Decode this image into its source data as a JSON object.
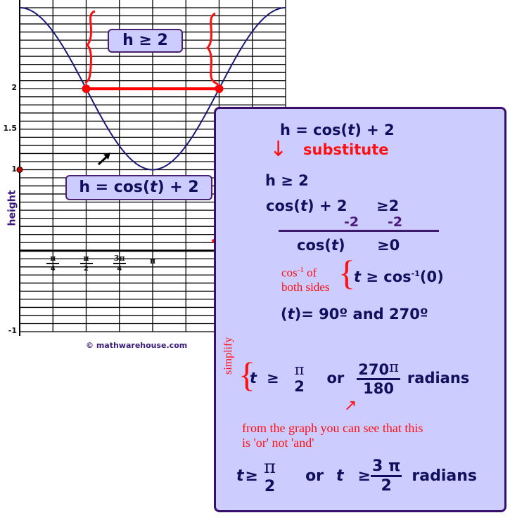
{
  "chart_data": {
    "type": "line",
    "function": "h = cos(t) + 2",
    "x_range_radians": [
      0,
      6.2832
    ],
    "ylim": [
      -1,
      3
    ],
    "ylabel": "height",
    "ytick_labels": [
      {
        "value": 2,
        "label": "2"
      },
      {
        "value": 1.5,
        "label": "1.5"
      },
      {
        "value": 1,
        "label": "1"
      },
      {
        "value": -1,
        "label": "-1"
      }
    ],
    "xtick_labels": [
      {
        "value": 0.7854,
        "num": "π",
        "den": "4"
      },
      {
        "value": 1.5708,
        "num": "π",
        "den": "2"
      },
      {
        "value": 2.3562,
        "num": "3π",
        "den": "4"
      },
      {
        "value": 3.1416,
        "num": "π",
        "den": ""
      }
    ],
    "grid": true,
    "grid_minor_y_step": 0.1,
    "grid_x_step_radians": 0.7854,
    "highlight_segment": {
      "x_start": 1.5708,
      "x_end": 4.7124,
      "y": 2,
      "color": "#ff0000"
    },
    "marked_point": {
      "x": 0,
      "y": 1
    },
    "curve_color": "#1a1a7a",
    "annotations": [
      "h ≥ 2",
      "h = cos(t) + 2"
    ]
  },
  "graph": {
    "region_label": "h ≥ 2",
    "function_label_prefix": "h = cos(",
    "function_label_var": "t",
    "function_label_suffix": ") + 2",
    "copyright": "© mathwarehouse.com"
  },
  "panel": {
    "line1_prefix": "h = cos(",
    "line1_var": "t",
    "line1_suffix": ") + 2",
    "substitute": "substitute",
    "arrow": "↓",
    "line2": "h ≥ 2",
    "line3_prefix": "cos(",
    "line3_var": "t",
    "line3_suffix": ") + 2",
    "line3_rhs": "≥2",
    "minus_left": "-2",
    "minus_right": "-2",
    "line4_prefix": "cos(",
    "line4_var": "t",
    "line4_suffix": ")",
    "line4_rhs": "≥0",
    "cos_inv_note_line1": "cos",
    "cos_inv_note_sup": "-1",
    "cos_inv_note_line1_rest": " of",
    "cos_inv_note_line2": "both sides",
    "line5_var": "t",
    "line5_rest": " ≥ cos",
    "line5_sup": "-1",
    "line5_end": "(0)",
    "line6_open": "(",
    "line6_var": "t",
    "line6_rest": ")= 90º and 270º",
    "simplify": "simplify",
    "line7_var": "t",
    "line7_ge": "≥",
    "line7_frac1_num": "π",
    "line7_frac1_den": "2",
    "line7_or": "or",
    "line7_frac2_num": "270",
    "line7_frac2_pi": "π",
    "line7_frac2_den": "180",
    "line7_unit": "radians",
    "note_line1": "from the graph you can see that this",
    "note_line2": "is 'or'  not 'and'",
    "final_var1": "t",
    "final_ge1": "≥",
    "final_frac1_num": "π",
    "final_frac1_den": "2",
    "final_or": "or",
    "final_var2": "t",
    "final_ge2": "≥",
    "final_frac2_num": "3 π",
    "final_frac2_den": "2",
    "final_unit": "radians"
  }
}
